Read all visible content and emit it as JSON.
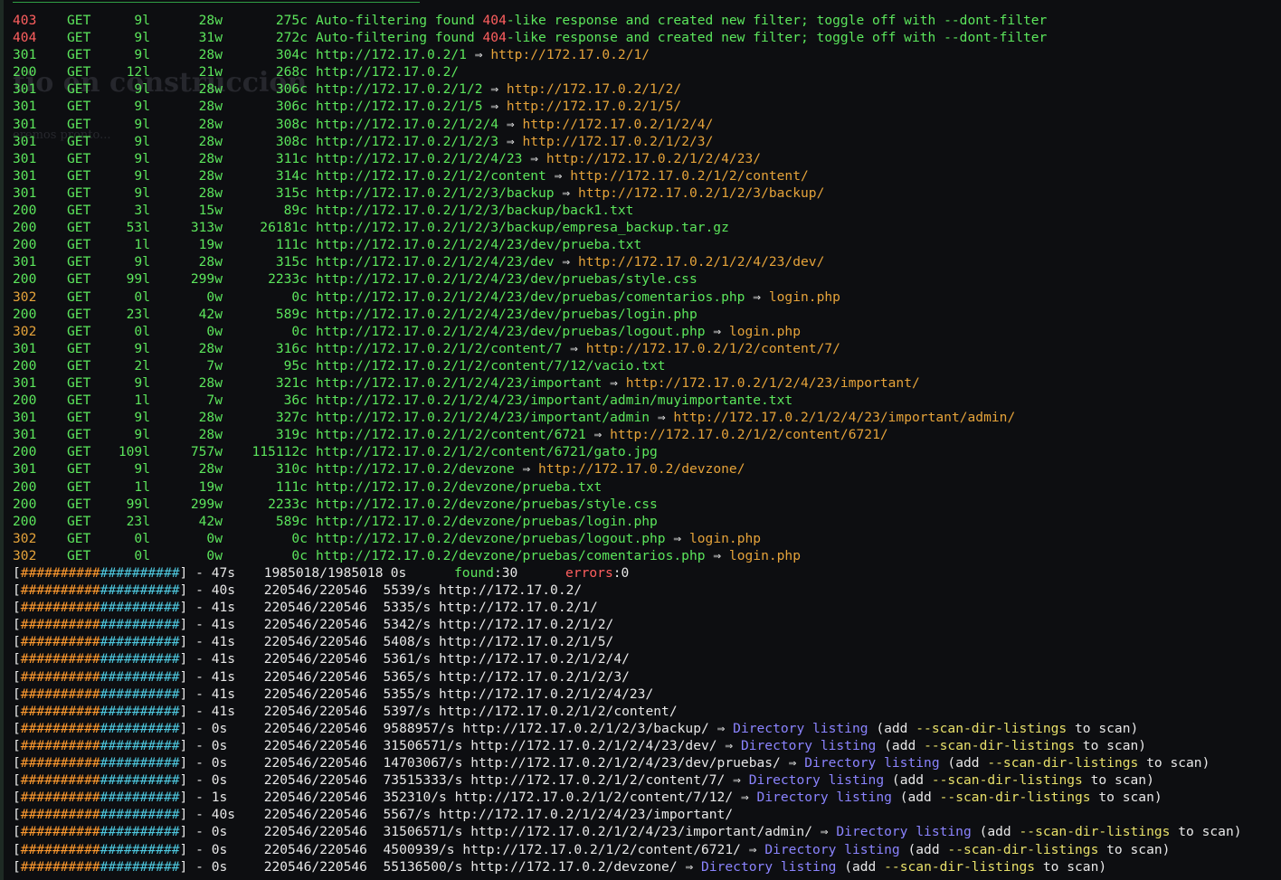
{
  "terminal": {
    "background_ghost_title": "tio en construcción",
    "background_ghost_sub": "eremos pronto...",
    "results": [
      {
        "status": "403",
        "method": "GET",
        "lines": "9l",
        "words": "28w",
        "chars": "275c",
        "type": "msg",
        "text_a": "Auto-filtering found ",
        "code": "404",
        "text_b": "-like response and created new filter; toggle off with --dont-filter"
      },
      {
        "status": "404",
        "method": "GET",
        "lines": "9l",
        "words": "31w",
        "chars": "272c",
        "type": "msg",
        "text_a": "Auto-filtering found ",
        "code": "404",
        "text_b": "-like response and created new filter; toggle off with --dont-filter"
      },
      {
        "status": "301",
        "method": "GET",
        "lines": "9l",
        "words": "28w",
        "chars": "304c",
        "url": "http://172.17.0.2/1",
        "target": "http://172.17.0.2/1/"
      },
      {
        "status": "200",
        "method": "GET",
        "lines": "12l",
        "words": "21w",
        "chars": "268c",
        "url": "http://172.17.0.2/"
      },
      {
        "status": "301",
        "method": "GET",
        "lines": "9l",
        "words": "28w",
        "chars": "306c",
        "url": "http://172.17.0.2/1/2",
        "target": "http://172.17.0.2/1/2/"
      },
      {
        "status": "301",
        "method": "GET",
        "lines": "9l",
        "words": "28w",
        "chars": "306c",
        "url": "http://172.17.0.2/1/5",
        "target": "http://172.17.0.2/1/5/"
      },
      {
        "status": "301",
        "method": "GET",
        "lines": "9l",
        "words": "28w",
        "chars": "308c",
        "url": "http://172.17.0.2/1/2/4",
        "target": "http://172.17.0.2/1/2/4/"
      },
      {
        "status": "301",
        "method": "GET",
        "lines": "9l",
        "words": "28w",
        "chars": "308c",
        "url": "http://172.17.0.2/1/2/3",
        "target": "http://172.17.0.2/1/2/3/"
      },
      {
        "status": "301",
        "method": "GET",
        "lines": "9l",
        "words": "28w",
        "chars": "311c",
        "url": "http://172.17.0.2/1/2/4/23",
        "target": "http://172.17.0.2/1/2/4/23/"
      },
      {
        "status": "301",
        "method": "GET",
        "lines": "9l",
        "words": "28w",
        "chars": "314c",
        "url": "http://172.17.0.2/1/2/content",
        "target": "http://172.17.0.2/1/2/content/"
      },
      {
        "status": "301",
        "method": "GET",
        "lines": "9l",
        "words": "28w",
        "chars": "315c",
        "url": "http://172.17.0.2/1/2/3/backup",
        "target": "http://172.17.0.2/1/2/3/backup/"
      },
      {
        "status": "200",
        "method": "GET",
        "lines": "3l",
        "words": "15w",
        "chars": "89c",
        "url": "http://172.17.0.2/1/2/3/backup/back1.txt"
      },
      {
        "status": "200",
        "method": "GET",
        "lines": "53l",
        "words": "313w",
        "chars": "26181c",
        "url": "http://172.17.0.2/1/2/3/backup/empresa_backup.tar.gz"
      },
      {
        "status": "200",
        "method": "GET",
        "lines": "1l",
        "words": "19w",
        "chars": "111c",
        "url": "http://172.17.0.2/1/2/4/23/dev/prueba.txt"
      },
      {
        "status": "301",
        "method": "GET",
        "lines": "9l",
        "words": "28w",
        "chars": "315c",
        "url": "http://172.17.0.2/1/2/4/23/dev",
        "target": "http://172.17.0.2/1/2/4/23/dev/"
      },
      {
        "status": "200",
        "method": "GET",
        "lines": "99l",
        "words": "299w",
        "chars": "2233c",
        "url": "http://172.17.0.2/1/2/4/23/dev/pruebas/style.css"
      },
      {
        "status": "302",
        "method": "GET",
        "lines": "0l",
        "words": "0w",
        "chars": "0c",
        "url": "http://172.17.0.2/1/2/4/23/dev/pruebas/comentarios.php",
        "target": "login.php"
      },
      {
        "status": "200",
        "method": "GET",
        "lines": "23l",
        "words": "42w",
        "chars": "589c",
        "url": "http://172.17.0.2/1/2/4/23/dev/pruebas/login.php"
      },
      {
        "status": "302",
        "method": "GET",
        "lines": "0l",
        "words": "0w",
        "chars": "0c",
        "url": "http://172.17.0.2/1/2/4/23/dev/pruebas/logout.php",
        "target": "login.php"
      },
      {
        "status": "301",
        "method": "GET",
        "lines": "9l",
        "words": "28w",
        "chars": "316c",
        "url": "http://172.17.0.2/1/2/content/7",
        "target": "http://172.17.0.2/1/2/content/7/"
      },
      {
        "status": "200",
        "method": "GET",
        "lines": "2l",
        "words": "7w",
        "chars": "95c",
        "url": "http://172.17.0.2/1/2/content/7/12/vacio.txt"
      },
      {
        "status": "301",
        "method": "GET",
        "lines": "9l",
        "words": "28w",
        "chars": "321c",
        "url": "http://172.17.0.2/1/2/4/23/important",
        "target": "http://172.17.0.2/1/2/4/23/important/"
      },
      {
        "status": "200",
        "method": "GET",
        "lines": "1l",
        "words": "7w",
        "chars": "36c",
        "url": "http://172.17.0.2/1/2/4/23/important/admin/muyimportante.txt"
      },
      {
        "status": "301",
        "method": "GET",
        "lines": "9l",
        "words": "28w",
        "chars": "327c",
        "url": "http://172.17.0.2/1/2/4/23/important/admin",
        "target": "http://172.17.0.2/1/2/4/23/important/admin/"
      },
      {
        "status": "301",
        "method": "GET",
        "lines": "9l",
        "words": "28w",
        "chars": "319c",
        "url": "http://172.17.0.2/1/2/content/6721",
        "target": "http://172.17.0.2/1/2/content/6721/"
      },
      {
        "status": "200",
        "method": "GET",
        "lines": "109l",
        "words": "757w",
        "chars": "115112c",
        "url": "http://172.17.0.2/1/2/content/6721/gato.jpg"
      },
      {
        "status": "301",
        "method": "GET",
        "lines": "9l",
        "words": "28w",
        "chars": "310c",
        "url": "http://172.17.0.2/devzone",
        "target": "http://172.17.0.2/devzone/"
      },
      {
        "status": "200",
        "method": "GET",
        "lines": "1l",
        "words": "19w",
        "chars": "111c",
        "url": "http://172.17.0.2/devzone/prueba.txt"
      },
      {
        "status": "200",
        "method": "GET",
        "lines": "99l",
        "words": "299w",
        "chars": "2233c",
        "url": "http://172.17.0.2/devzone/pruebas/style.css"
      },
      {
        "status": "200",
        "method": "GET",
        "lines": "23l",
        "words": "42w",
        "chars": "589c",
        "url": "http://172.17.0.2/devzone/pruebas/login.php"
      },
      {
        "status": "302",
        "method": "GET",
        "lines": "0l",
        "words": "0w",
        "chars": "0c",
        "url": "http://172.17.0.2/devzone/pruebas/logout.php",
        "target": "login.php"
      },
      {
        "status": "302",
        "method": "GET",
        "lines": "0l",
        "words": "0w",
        "chars": "0c",
        "url": "http://172.17.0.2/devzone/pruebas/comentarios.php",
        "target": "login.php"
      }
    ],
    "arrow": "⇒",
    "overall": {
      "bar": "####################",
      "time": "47s",
      "count": "1985018/1985018",
      "rate": "0s",
      "found_label": "found",
      "found": "30",
      "errors_label": "errors",
      "errors": "0"
    },
    "progress": [
      {
        "bar": "####################",
        "time": "40s",
        "count": "220546/220546",
        "rate": "5539/s",
        "url": "http://172.17.0.2/"
      },
      {
        "bar": "####################",
        "time": "41s",
        "count": "220546/220546",
        "rate": "5335/s",
        "url": "http://172.17.0.2/1/"
      },
      {
        "bar": "####################",
        "time": "41s",
        "count": "220546/220546",
        "rate": "5342/s",
        "url": "http://172.17.0.2/1/2/"
      },
      {
        "bar": "####################",
        "time": "41s",
        "count": "220546/220546",
        "rate": "5408/s",
        "url": "http://172.17.0.2/1/5/"
      },
      {
        "bar": "####################",
        "time": "41s",
        "count": "220546/220546",
        "rate": "5361/s",
        "url": "http://172.17.0.2/1/2/4/"
      },
      {
        "bar": "####################",
        "time": "41s",
        "count": "220546/220546",
        "rate": "5365/s",
        "url": "http://172.17.0.2/1/2/3/"
      },
      {
        "bar": "####################",
        "time": "41s",
        "count": "220546/220546",
        "rate": "5355/s",
        "url": "http://172.17.0.2/1/2/4/23/"
      },
      {
        "bar": "####################",
        "time": "41s",
        "count": "220546/220546",
        "rate": "5397/s",
        "url": "http://172.17.0.2/1/2/content/"
      },
      {
        "bar": "####################",
        "time": "0s",
        "count": "220546/220546",
        "rate": "9588957/s",
        "url": "http://172.17.0.2/1/2/3/backup/",
        "dir": true
      },
      {
        "bar": "####################",
        "time": "0s",
        "count": "220546/220546",
        "rate": "31506571/s",
        "url": "http://172.17.0.2/1/2/4/23/dev/",
        "dir": true
      },
      {
        "bar": "####################",
        "time": "0s",
        "count": "220546/220546",
        "rate": "14703067/s",
        "url": "http://172.17.0.2/1/2/4/23/dev/pruebas/",
        "dir": true
      },
      {
        "bar": "####################",
        "time": "0s",
        "count": "220546/220546",
        "rate": "73515333/s",
        "url": "http://172.17.0.2/1/2/content/7/",
        "dir": true
      },
      {
        "bar": "####################",
        "time": "1s",
        "count": "220546/220546",
        "rate": "352310/s",
        "url": "http://172.17.0.2/1/2/content/7/12/",
        "dir": true
      },
      {
        "bar": "####################",
        "time": "40s",
        "count": "220546/220546",
        "rate": "5567/s",
        "url": "http://172.17.0.2/1/2/4/23/important/"
      },
      {
        "bar": "####################",
        "time": "0s",
        "count": "220546/220546",
        "rate": "31506571/s",
        "url": "http://172.17.0.2/1/2/4/23/important/admin/",
        "dir": true
      },
      {
        "bar": "####################",
        "time": "0s",
        "count": "220546/220546",
        "rate": "4500939/s",
        "url": "http://172.17.0.2/1/2/content/6721/",
        "dir": true
      },
      {
        "bar": "####################",
        "time": "0s",
        "count": "220546/220546",
        "rate": "55136500/s",
        "url": "http://172.17.0.2/devzone/",
        "dir": true
      }
    ],
    "dir_listing": {
      "label": "Directory listing",
      "open": "(add ",
      "flag": "--scan-dir-listings",
      "close": " to scan)"
    },
    "colors": {
      "ok": "#5ce65c",
      "redirect_target": "#e5a33a",
      "error": "#ff5f5f",
      "bar_left": "#ff9a2e",
      "bar_right": "#4ec9e0",
      "dir_listing": "#8b84ff",
      "flag": "#e8e06a"
    }
  }
}
